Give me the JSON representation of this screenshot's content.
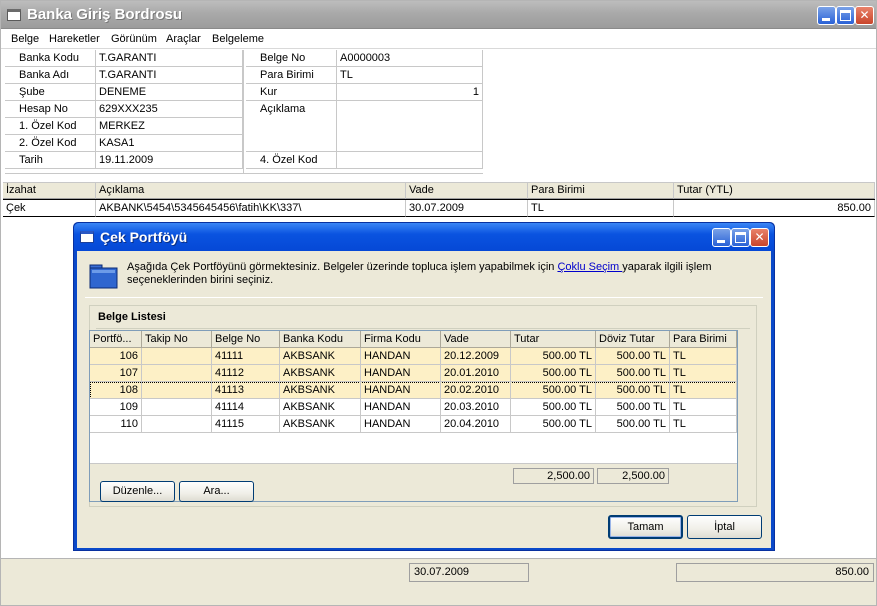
{
  "window": {
    "title": "Banka Giriş Bordrosu",
    "menu": [
      "Belge",
      "Hareketler",
      "Görünüm",
      "Araçlar",
      "Belgeleme"
    ]
  },
  "form": {
    "left": [
      {
        "label": "Banka Kodu",
        "value": "T.GARANTI"
      },
      {
        "label": "Banka Adı",
        "value": "T.GARANTI"
      },
      {
        "label": "Şube",
        "value": "DENEME"
      },
      {
        "label": "Hesap No",
        "value": "629XXX235"
      },
      {
        "label": "1. Özel Kod",
        "value": "MERKEZ"
      },
      {
        "label": "2. Özel Kod",
        "value": "KASA1"
      },
      {
        "label": "Tarih",
        "value": "19.11.2009"
      }
    ],
    "right": [
      {
        "label": "Belge No",
        "value": "A0000003"
      },
      {
        "label": "Para Birimi",
        "value": "TL"
      },
      {
        "label": "Kur",
        "value": "1"
      },
      {
        "label": "Açıklama",
        "value": ""
      },
      {
        "label": "4. Özel Kod",
        "value": ""
      }
    ]
  },
  "grid": {
    "columns": [
      "İzahat",
      "Açıklama",
      "Vade",
      "Para Birimi",
      "Tutar (YTL)"
    ],
    "rows": [
      [
        "Çek",
        "AKBANK\\5454\\5345645456\\fatih\\KK\\337\\",
        "30.07.2009",
        "TL",
        "850.00"
      ]
    ]
  },
  "footer": {
    "vade": "30.07.2009",
    "tutar": "850.00"
  },
  "dialog": {
    "title": "Çek Portföyü",
    "intro_before": "Aşağıda Çek Portföyünü görmektesiniz. Belgeler üzerinde topluca işlem yapabilmek için ",
    "intro_link": "Çoklu Seçim ",
    "intro_after": "yaparak ilgili işlem seçeneklerinden birini seçiniz.",
    "group_title": "Belge Listesi",
    "columns": [
      "Portfö...",
      "Takip No",
      "Belge No",
      "Banka Kodu",
      "Firma Kodu",
      "Vade",
      "Tutar",
      "Döviz Tutar",
      "Para Birimi"
    ],
    "rows": [
      [
        "106",
        "",
        "41111",
        "AKBSANK",
        "HANDAN",
        "20.12.2009",
        "500.00 TL",
        "500.00 TL",
        "TL"
      ],
      [
        "107",
        "",
        "41112",
        "AKBSANK",
        "HANDAN",
        "20.01.2010",
        "500.00 TL",
        "500.00 TL",
        "TL"
      ],
      [
        "108",
        "",
        "41113",
        "AKBSANK",
        "HANDAN",
        "20.02.2010",
        "500.00 TL",
        "500.00 TL",
        "TL"
      ],
      [
        "109",
        "",
        "41114",
        "AKBSANK",
        "HANDAN",
        "20.03.2010",
        "500.00 TL",
        "500.00 TL",
        "TL"
      ],
      [
        "110",
        "",
        "41115",
        "AKBSANK",
        "HANDAN",
        "20.04.2010",
        "500.00 TL",
        "500.00 TL",
        "TL"
      ]
    ],
    "sum_tutar": "2,500.00",
    "sum_doviz": "2,500.00",
    "btn_duzenle": "Düzenle...",
    "btn_ara": "Ara...",
    "btn_tamam": "Tamam",
    "btn_iptal": "İptal"
  },
  "colors": {
    "title_inactive": "#a9a9a9",
    "title_active": "#0a53e0",
    "row_highlight": "#fdf0c6"
  }
}
